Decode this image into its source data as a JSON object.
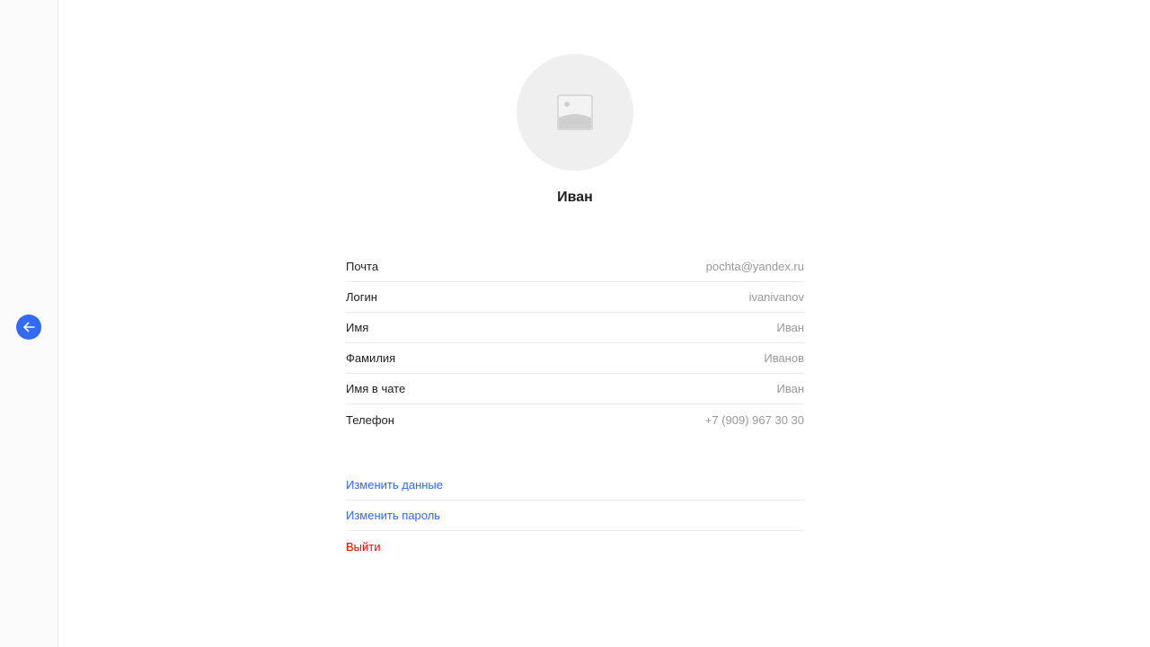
{
  "profile": {
    "display_name": "Иван"
  },
  "fields": [
    {
      "label": "Почта",
      "value": "pochta@yandex.ru"
    },
    {
      "label": "Логин",
      "value": "ivanivanov"
    },
    {
      "label": "Имя",
      "value": "Иван"
    },
    {
      "label": "Фамилия",
      "value": "Иванов"
    },
    {
      "label": "Имя в чате",
      "value": "Иван"
    },
    {
      "label": "Телефон",
      "value": "+7 (909) 967 30 30"
    }
  ],
  "actions": {
    "edit_data": "Изменить данные",
    "edit_password": "Изменить пароль",
    "logout": "Выйти"
  },
  "icons": {
    "back": "arrow-left-icon",
    "avatar": "image-placeholder-icon"
  },
  "colors": {
    "accent": "#3369f3",
    "danger": "#ff0000",
    "muted": "#999999",
    "divider": "#eaeaea"
  }
}
